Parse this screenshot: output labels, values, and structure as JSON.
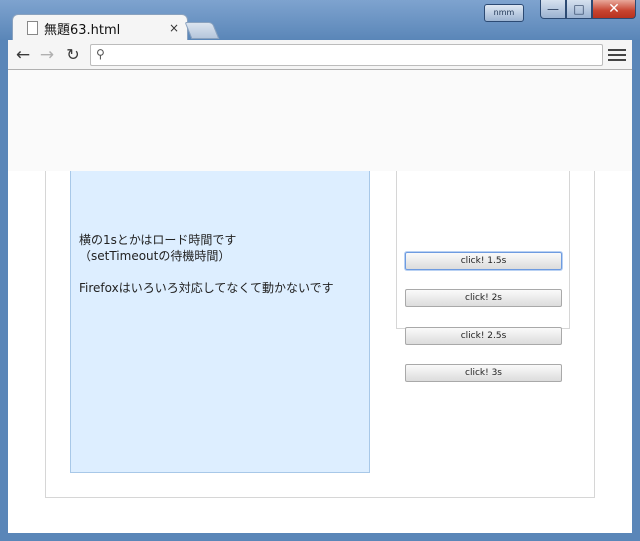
{
  "window": {
    "user_badge": "nmm",
    "minimize_glyph": "—",
    "maximize_glyph": "□",
    "close_glyph": "✕"
  },
  "tab": {
    "title": "無題63.html",
    "close_glyph": "×",
    "icon": "document-icon"
  },
  "toolbar": {
    "back_glyph": "←",
    "forward_glyph": "→",
    "reload_glyph": "↻",
    "search_glyph": "⚲",
    "address_value": "",
    "address_placeholder": ""
  },
  "content": {
    "info_lines": [
      "横の1sとかはロード時間です",
      "（setTimeoutの待機時間）",
      "Firefoxはいろいろ対応してなくて動かないです"
    ],
    "buttons": [
      {
        "label": "click! 1.5s"
      },
      {
        "label": "click! 2s"
      },
      {
        "label": "click! 2.5s"
      },
      {
        "label": "click! 3s"
      }
    ]
  },
  "colors": {
    "info_panel_bg": "#ddeeff",
    "info_panel_border": "#a8c8e8",
    "focus_ring": "#6e9be0"
  }
}
